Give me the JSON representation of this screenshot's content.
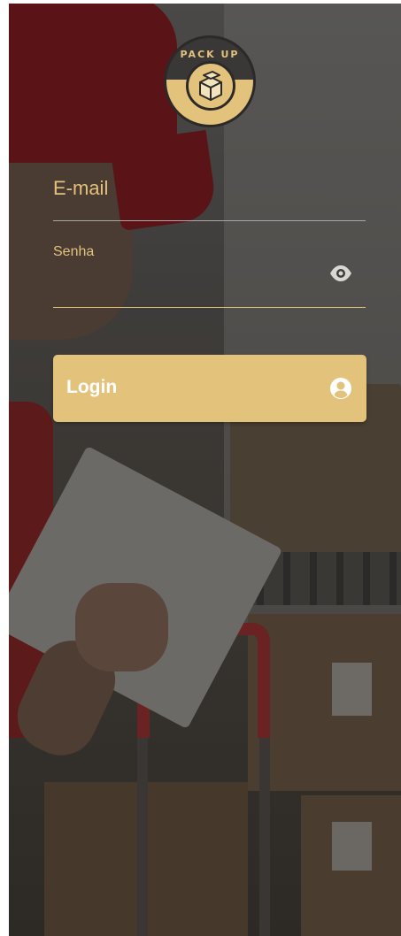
{
  "logo": {
    "brand_text": "PACK UP"
  },
  "form": {
    "email_label": "E-mail",
    "password_label": "Senha",
    "password_toggle_icon": "eye-icon",
    "login_button_label": "Login",
    "login_button_icon": "user-circle-icon"
  },
  "colors": {
    "accent": "#e3c27c",
    "overlay": "#3f3d3b",
    "underline_inactive": "#a9a7a3"
  }
}
